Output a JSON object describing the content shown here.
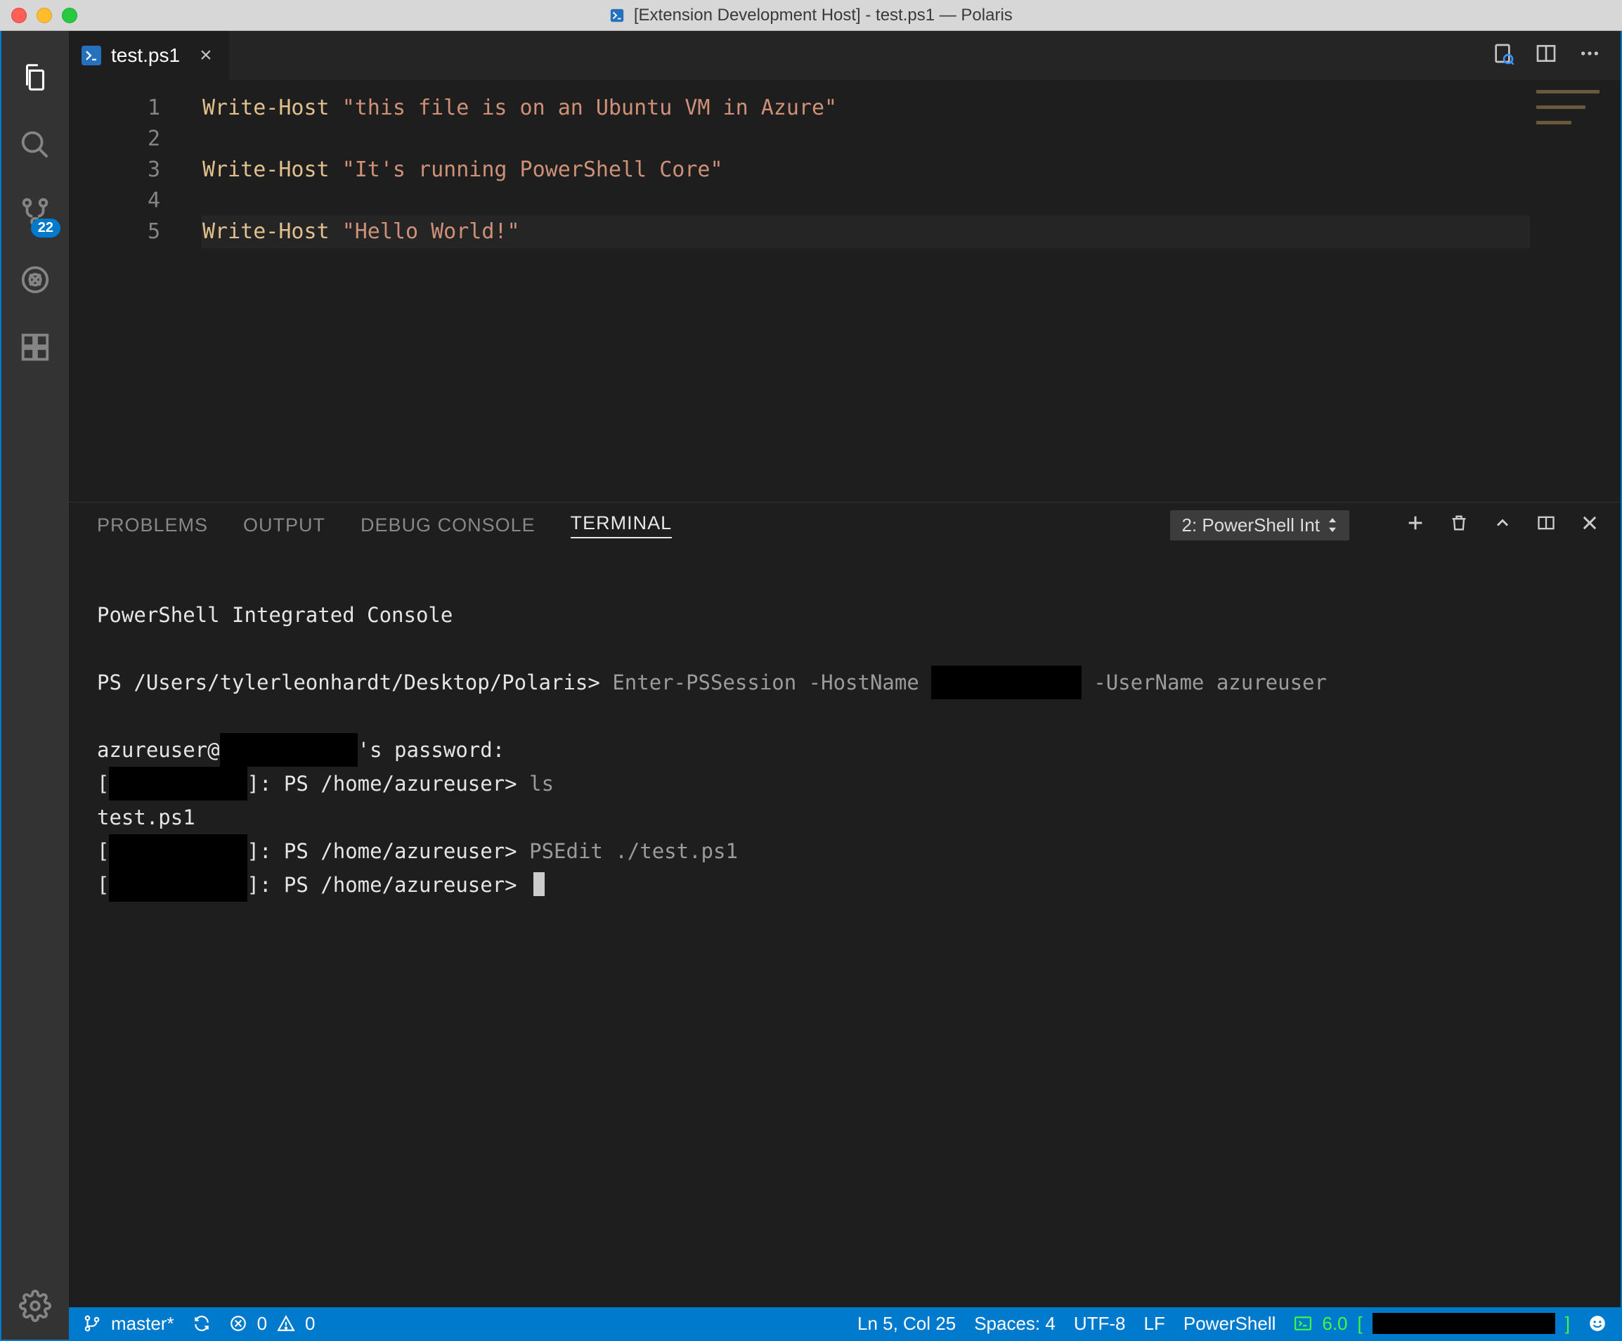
{
  "window": {
    "title": "[Extension Development Host] - test.ps1 — Polaris"
  },
  "activitybar": {
    "scm_badge": "22"
  },
  "tabs": {
    "file": "test.ps1"
  },
  "editor": {
    "gutter": [
      "1",
      "2",
      "3",
      "4",
      "5"
    ],
    "lines": [
      {
        "cmd": "Write-Host",
        "str": "\"this file is on an Ubuntu VM in Azure\""
      },
      {
        "cmd": "",
        "str": ""
      },
      {
        "cmd": "Write-Host",
        "str": "\"It's running PowerShell Core\""
      },
      {
        "cmd": "",
        "str": ""
      },
      {
        "cmd": "Write-Host",
        "str": "\"Hello World!\""
      }
    ]
  },
  "panel": {
    "tabs": {
      "problems": "PROBLEMS",
      "output": "OUTPUT",
      "debug": "DEBUG CONSOLE",
      "terminal": "TERMINAL"
    },
    "terminal_selector": "2: PowerShell Int"
  },
  "terminal": {
    "line1": "PowerShell Integrated Console",
    "prompt1": "PS /Users/tylerleonhardt/Desktop/Polaris>",
    "cmd1a": "Enter-PSSession -HostName ",
    "cmd1b": " -UserName azureuser",
    "pwline_a": "azureuser@",
    "pwline_b": "'s password:",
    "remote_prompt": "]: PS /home/azureuser>",
    "ls": "ls",
    "ls_out": "test.ps1",
    "psedit": "PSEdit ./test.ps1"
  },
  "status": {
    "branch": "master*",
    "errors": "0",
    "warnings": "0",
    "lncol": "Ln 5, Col 25",
    "spaces": "Spaces: 4",
    "encoding": "UTF-8",
    "eol": "LF",
    "language": "PowerShell",
    "ps_version": "6.0"
  }
}
